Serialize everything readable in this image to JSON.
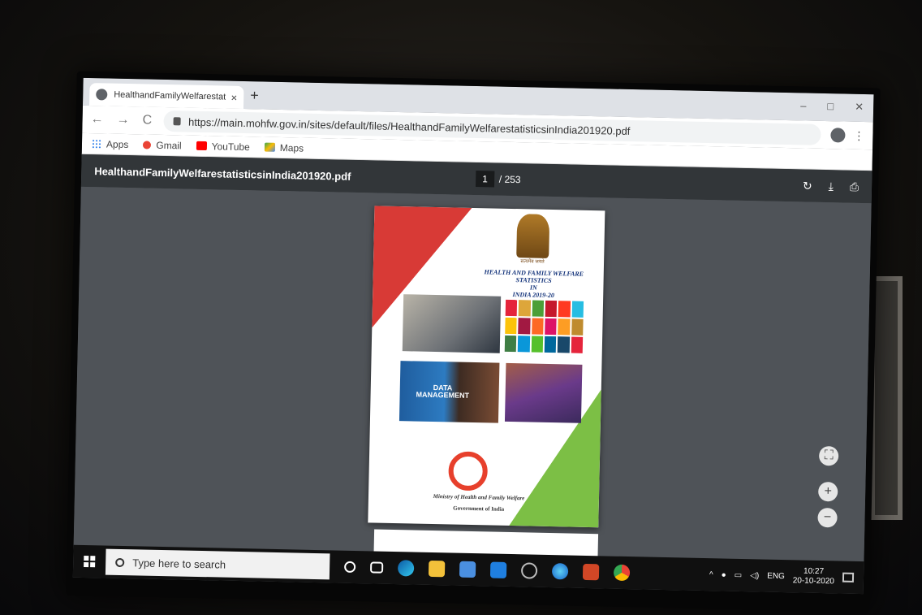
{
  "browser": {
    "tab_title": "HealthandFamilyWelfarestatistic",
    "tab_close": "×",
    "new_tab": "+",
    "window_controls": {
      "minimize": "–",
      "restore": "□",
      "close": "✕"
    },
    "nav": {
      "back": "←",
      "forward": "→",
      "reload": "C"
    },
    "url": "https://main.mohfw.gov.in/sites/default/files/HealthandFamilyWelfarestatisticsinIndia201920.pdf",
    "menu": "⋮"
  },
  "bookmarks": [
    {
      "label": "Apps",
      "icon": "apps-grid-icon",
      "color": "#1a73e8"
    },
    {
      "label": "Gmail",
      "icon": "google-g-icon",
      "color": "#ea4335"
    },
    {
      "label": "YouTube",
      "icon": "youtube-icon",
      "color": "#ff0000"
    },
    {
      "label": "Maps",
      "icon": "maps-icon",
      "color": "#34a853"
    }
  ],
  "pdf_viewer": {
    "file_name": "HealthandFamilyWelfarestatisticsinIndia201920.pdf",
    "current_page": "1",
    "total_pages": "/ 253",
    "tools": {
      "rotate": "↻",
      "download": "⤓",
      "print": "⎙"
    }
  },
  "document": {
    "emblem_caption": "सत्यमेव जयते",
    "title_line1": "HEALTH AND FAMILY WELFARE STATISTICS",
    "title_line2": "IN",
    "title_line3": "INDIA 2019-20",
    "data_mgmt_line1": "DATA",
    "data_mgmt_line2": "MANAGEMENT",
    "ministry": "Ministry of Health and Family Welfare",
    "government": "Government of India"
  },
  "zoom": {
    "fit": "⛶",
    "in": "+",
    "out": "−"
  },
  "taskbar": {
    "search_placeholder": "Type here to search",
    "tray_language": "ENG",
    "time": "10:27",
    "date": "20-10-2020"
  },
  "colors": {
    "sdg": [
      "#e5243b",
      "#dda63a",
      "#4c9f38",
      "#c5192d",
      "#ff3a21",
      "#26bde2",
      "#fcc30b",
      "#a21942",
      "#fd6925",
      "#dd1367",
      "#fd9d24",
      "#bf8b2e",
      "#3f7e44",
      "#0a97d9",
      "#56c02b",
      "#00689d",
      "#19486a",
      "#e5243b"
    ]
  }
}
